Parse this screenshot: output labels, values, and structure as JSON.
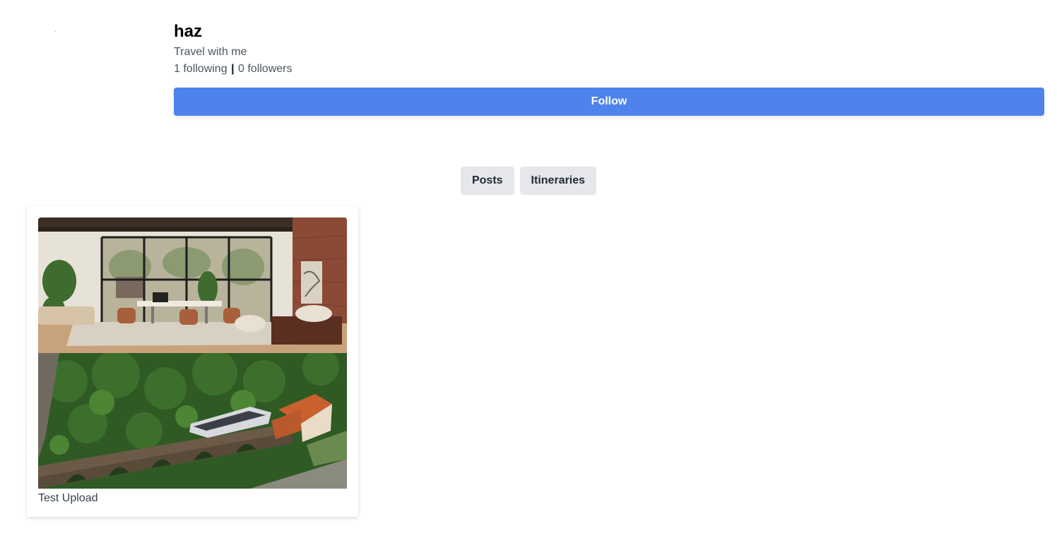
{
  "profile": {
    "username": "haz",
    "bio": "Travel with me",
    "following": "1 following",
    "separator": "|",
    "followers": "0 followers"
  },
  "actions": {
    "follow_label": "Follow"
  },
  "tabs": [
    {
      "label": "Posts"
    },
    {
      "label": "Itineraries"
    }
  ],
  "posts": [
    {
      "caption": "Test Upload",
      "images": [
        "office-interior-photo",
        "railway-viaduct-photo"
      ]
    }
  ],
  "colors": {
    "accent": "#4f83ec",
    "tab_bg": "#e5e7eb"
  }
}
